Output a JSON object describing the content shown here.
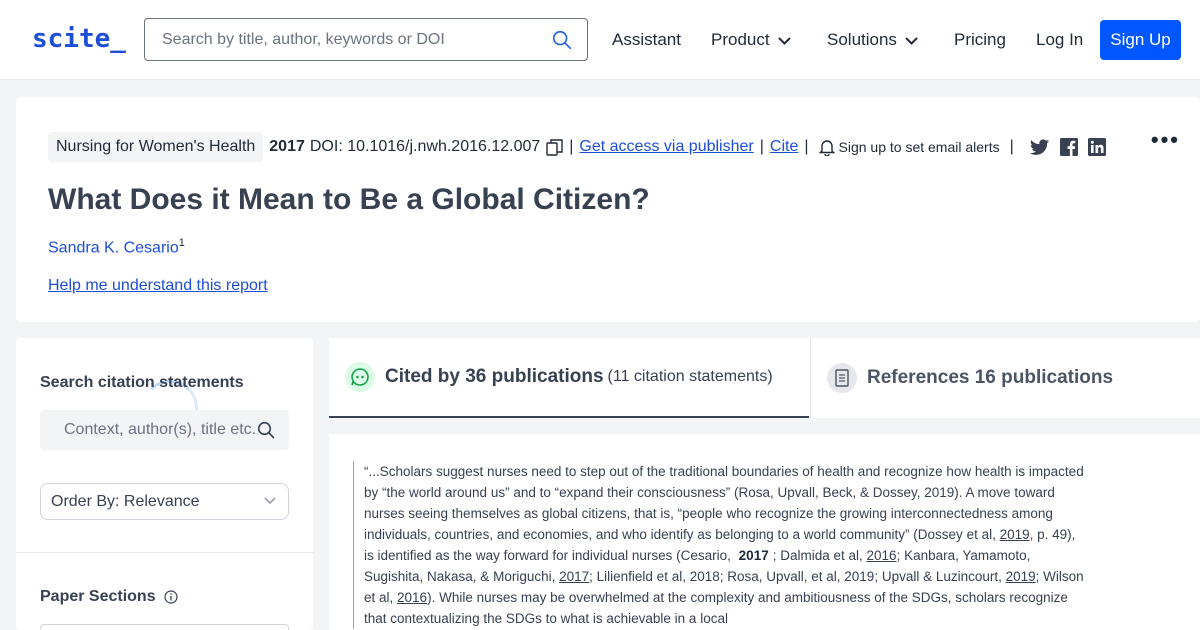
{
  "nav": {
    "logo": "scite_",
    "search_placeholder": "Search by title, author, keywords or DOI",
    "items": {
      "assistant": "Assistant",
      "product": "Product",
      "solutions": "Solutions",
      "pricing": "Pricing",
      "login": "Log In",
      "signup": "Sign Up"
    }
  },
  "paper": {
    "journal": "Nursing for Women's Health",
    "year": "2017",
    "doi": "DOI: 10.1016/j.nwh.2016.12.007",
    "access_link": "Get access via publisher",
    "cite_link": "Cite",
    "alerts": "Sign up to set email alerts",
    "title": "What Does it Mean to Be a Global Citizen?",
    "author": "Sandra K. Cesario",
    "author_sup": "1",
    "help_link": "Help me understand this report"
  },
  "sidebar": {
    "search_heading": "Search citation statements",
    "search_placeholder": "Context, author(s), title etc.",
    "order_by": "Order By: Relevance",
    "sections_heading": "Paper Sections"
  },
  "tabs": {
    "cited_by": "Cited by 36 publications",
    "cited_by_sub": "(11 citation statements)",
    "references": "References 16 publications"
  },
  "citation": {
    "p1": "“...Scholars suggest nurses need to step out of the traditional boundaries of health and recognize how health is impacted by “the world around us” and to “expand their consciousness” (Rosa, Upvall, Beck, & Dossey, 2019). A move toward nurses seeing themselves as global citizens, that is, “people who recognize the growing interconnectedness among individuals, countries, and economies, and who identify as belonging to a world community” (Dossey et al, ",
    "y2019a": "2019",
    "p2": ", p. 49), is identified as the way forward for individual nurses (Cesario, ",
    "highlight": "2017",
    "p3": "; Dalmida et al, ",
    "y2016a": "2016",
    "p4": "; Kanbara, Yamamoto, Sugishita, Nakasa, & Moriguchi, ",
    "y2017": "2017",
    "p5": "; Lilienfield et al, 2018; Rosa, Upvall, et al, 2019; Upvall & Luzincourt, ",
    "y2019b": "2019",
    "p6": "; Wilson et al, ",
    "y2016b": "2016",
    "p7": "). While nurses may be overwhelmed at the complexity and ambitiousness of the SDGs, scholars recognize that contextualizing the SDGs to what is achievable in a local"
  },
  "colors": {
    "brand": "#1d4ed8",
    "signup_bg": "#0057ff",
    "cited_icon_bg": "#dcfce7",
    "cited_icon": "#16a34a"
  }
}
